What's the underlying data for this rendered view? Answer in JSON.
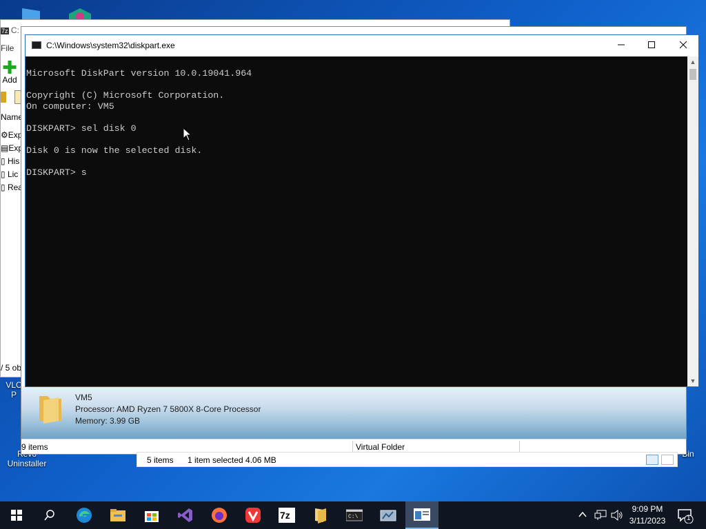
{
  "desktop": {
    "icons": [
      {
        "label": "VLC\nP",
        "name": "vlc"
      },
      {
        "label": "Revo\nUninstaller",
        "name": "revo-uninstaller"
      },
      {
        "label": "Bin",
        "name": "recycle-bin"
      }
    ]
  },
  "sevenzip": {
    "title_fragment": "7z",
    "title_c": "C:",
    "menu_file": "File",
    "add_label": "Add",
    "column_name": "Name",
    "rows": [
      "Exp",
      "Exp",
      "His",
      "Lic",
      "Rea"
    ],
    "status": "/ 5 ob"
  },
  "explorer": {
    "details": {
      "name": "VM5",
      "processor": "Processor: AMD Ryzen 7 5800X 8-Core Processor",
      "memory": "Memory: 3.99 GB"
    },
    "status_items": "9 items",
    "status_type": "Virtual Folder"
  },
  "thispc": {
    "items": "5 items",
    "selected": "1 item selected  4.06 MB"
  },
  "cmd": {
    "title": "C:\\Windows\\system32\\diskpart.exe",
    "lines": [
      "Microsoft DiskPart version 10.0.19041.964",
      "",
      "Copyright (C) Microsoft Corporation.",
      "On computer: VM5",
      "",
      "DISKPART> sel disk 0",
      "",
      "Disk 0 is now the selected disk.",
      "",
      "DISKPART> s"
    ]
  },
  "taskbar": {
    "apps": [
      "start",
      "search",
      "edge",
      "file-explorer",
      "store",
      "visual-studio",
      "firefox",
      "vivaldi",
      "7zip",
      "folder",
      "cmd",
      "server-manager",
      "explorer-active"
    ],
    "time": "9:09 PM",
    "date": "3/11/2023",
    "notification_count": "1"
  },
  "colors": {
    "console_bg": "#0c0c0c",
    "console_fg": "#cccccc",
    "taskbar_bg": "#101522",
    "accent": "#76b9ed"
  }
}
